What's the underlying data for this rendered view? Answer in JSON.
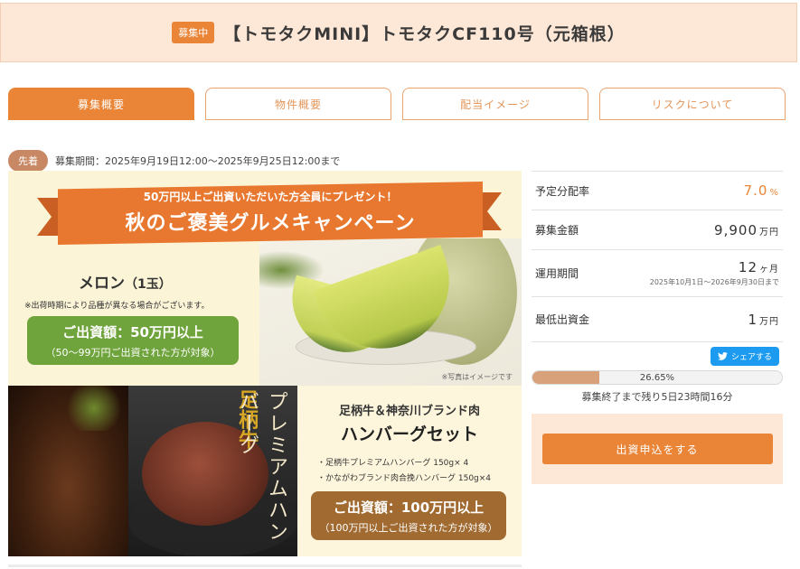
{
  "header": {
    "status_badge": "募集中",
    "title": "【トモタクMINI】トモタクCF110号（元箱根）"
  },
  "tabs": [
    {
      "label": "募集概要",
      "active": true
    },
    {
      "label": "物件概要",
      "active": false
    },
    {
      "label": "配当イメージ",
      "active": false
    },
    {
      "label": "リスクについて",
      "active": false
    }
  ],
  "period": {
    "badge": "先着",
    "text": "募集期間：2025年9月19日12:00〜2025年9月25日12:00まで"
  },
  "banner": {
    "ribbon_sub": "50万円以上ご出資いただいた方全員にプレゼント！",
    "ribbon_main": "秋のご褒美グルメキャンペーン",
    "melon_title": "メロン",
    "melon_qty": "（1玉）",
    "melon_note": "※出荷時期により品種が異なる場合がございます。",
    "melon_amount": "ご出資額：50万円以上",
    "melon_condition": "（50〜99万円ご出資された方が対象）",
    "photo_note": "※写真はイメージです",
    "vertical_gold": "足柄牛",
    "vertical_text": "プレミアムハンバーグ",
    "hamburg_sub": "足柄牛＆神奈川ブランド肉",
    "hamburg_title": "ハンバーグセット",
    "hamburg_items": [
      "・足柄牛プレミアムハンバーグ 150g× 4",
      "・かながわブランド肉合挽ハンバーグ 150g×4"
    ],
    "hamburg_amount": "ご出資額：100万円以上",
    "hamburg_condition": "（100万円以上ご出資された方が対象）"
  },
  "info": {
    "dividend_label": "予定分配率",
    "dividend_value": "7.0",
    "dividend_unit": "%",
    "amount_label": "募集金額",
    "amount_value": "9,900",
    "amount_unit": "万円",
    "term_label": "運用期間",
    "term_value": "12",
    "term_unit": "ヶ月",
    "term_range": "2025年10月1日〜2026年9月30日まで",
    "min_label": "最低出資金",
    "min_value": "1",
    "min_unit": "万円"
  },
  "share": {
    "label": "シェアする"
  },
  "progress": {
    "percent_text": "26.65%",
    "fraction": 0.2665,
    "remaining": "募集終了まで残り5日23時間16分"
  },
  "apply": {
    "label": "出資申込をする"
  },
  "colors": {
    "accent": "#ea8437",
    "header_bg": "#fde7d6",
    "progress_fill": "#d9a17a",
    "twitter": "#1d9bf0"
  }
}
